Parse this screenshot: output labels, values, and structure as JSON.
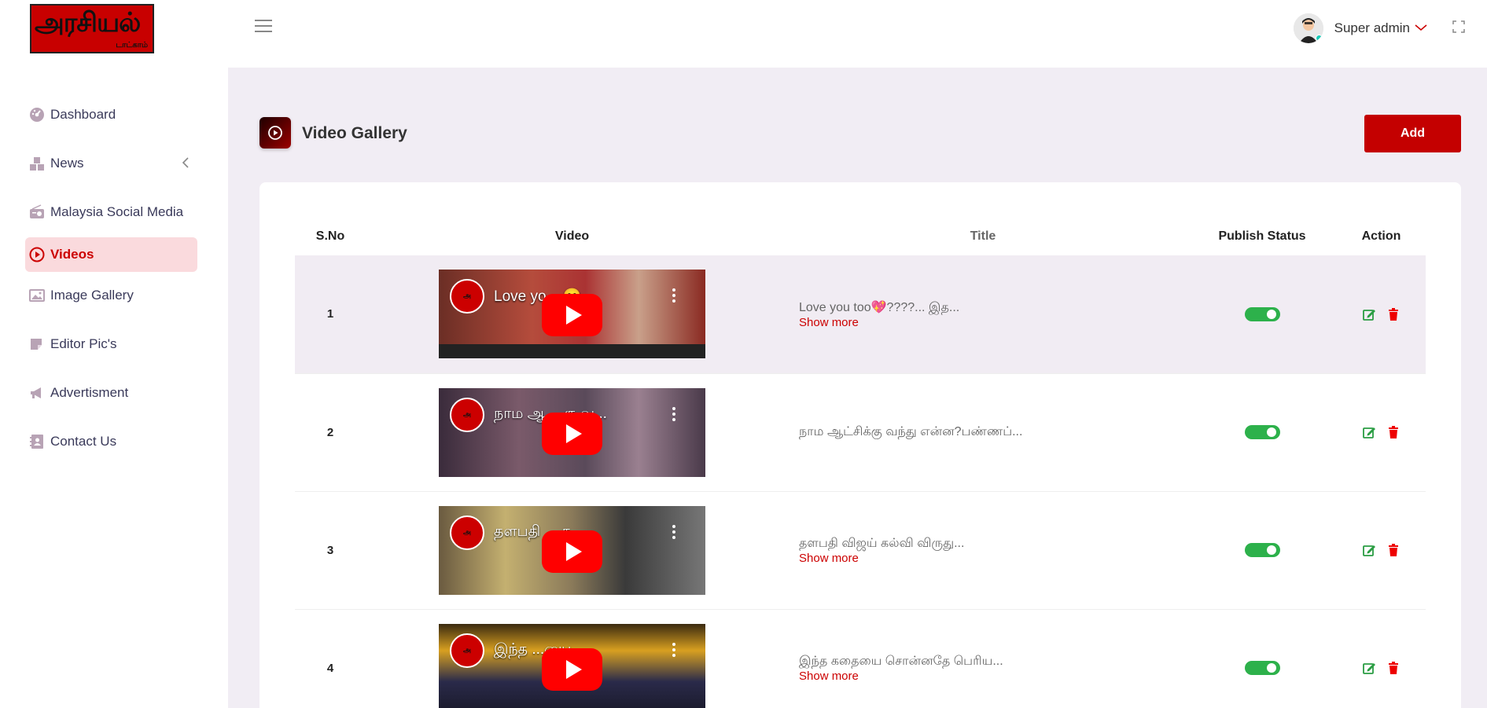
{
  "brand": {
    "logo_text": "அரசியல்",
    "logo_sub": "டாட்காம்"
  },
  "sidebar": {
    "items": [
      {
        "label": "Dashboard",
        "icon": "dashboard-icon"
      },
      {
        "label": "News",
        "icon": "news-icon",
        "has_chevron": true
      },
      {
        "label": "Malaysia Social Media",
        "icon": "radio-icon"
      },
      {
        "label": "Videos",
        "icon": "play-circle-icon",
        "active": true
      },
      {
        "label": "Image Gallery",
        "icon": "image-icon"
      },
      {
        "label": "Editor Pic's",
        "icon": "edit-note-icon"
      },
      {
        "label": "Advertisment",
        "icon": "megaphone-icon"
      },
      {
        "label": "Contact Us",
        "icon": "contact-icon"
      }
    ]
  },
  "header": {
    "username": "Super admin"
  },
  "page": {
    "title": "Video Gallery",
    "add_label": "Add"
  },
  "table": {
    "headers": {
      "sno": "S.No",
      "video": "Video",
      "title": "Title",
      "status": "Publish Status",
      "action": "Action"
    },
    "rows": [
      {
        "sno": "1",
        "video_title": "Love yo... 😊...",
        "title": "Love you too💖????... இத...",
        "show_more": "Show more",
        "published": true
      },
      {
        "sno": "2",
        "video_title": "நாம ஆ... கு வ...",
        "title": "நாம ஆட்சிக்கு வந்து என்ன?பண்ணப்...",
        "show_more": "",
        "published": true
      },
      {
        "sno": "3",
        "video_title": "தளபதி ... க...",
        "title": "தளபதி விஜய் கல்வி விருது...",
        "show_more": "Show more",
        "published": true
      },
      {
        "sno": "4",
        "video_title": "இந்த ...யை ...",
        "title": "இந்த கதையை சொன்னதே பெரிய...",
        "show_more": "Show more",
        "published": true
      }
    ]
  },
  "colors": {
    "accent": "#c40000",
    "active_bg": "#fadadd",
    "toggle_on": "#2db14b",
    "page_bg": "#f1edf4"
  }
}
